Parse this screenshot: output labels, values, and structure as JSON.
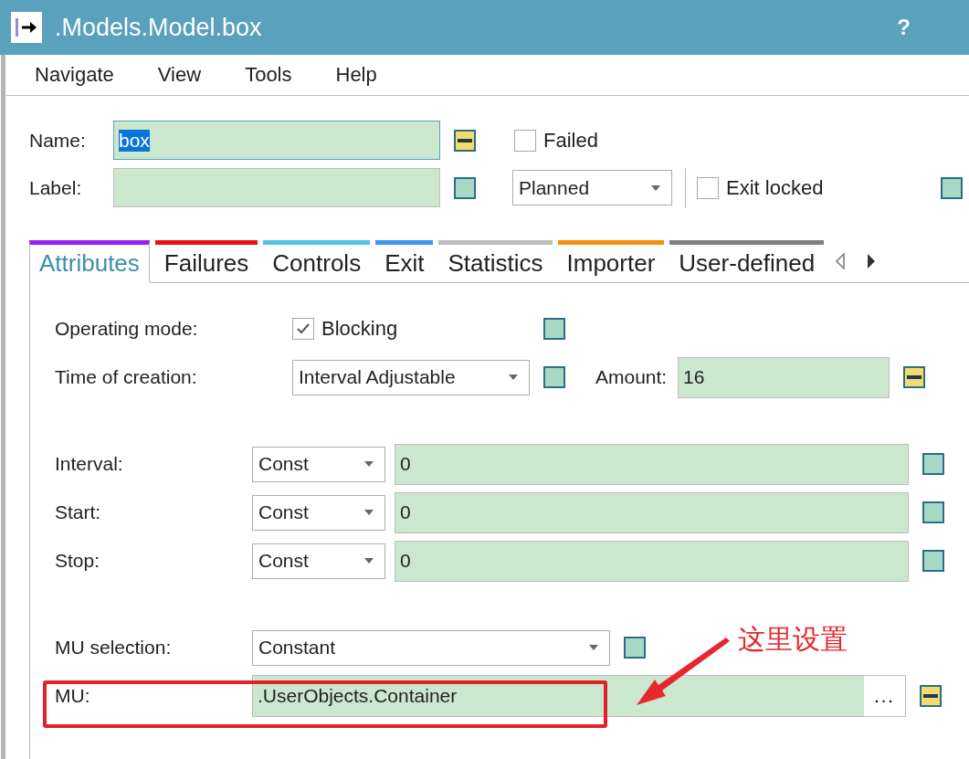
{
  "window": {
    "title": ".Models.Model.box",
    "help": "?"
  },
  "menu": [
    "Navigate",
    "View",
    "Tools",
    "Help"
  ],
  "header": {
    "name": {
      "label": "Name:",
      "value": "box",
      "text_selected": true,
      "inherited": false
    },
    "label": {
      "label": "Label:",
      "inherited": true
    },
    "failed": {
      "label": "Failed",
      "checked": false
    },
    "state": {
      "value": "Planned"
    },
    "exit_locked": {
      "label": "Exit locked",
      "checked": false,
      "inherited": true
    }
  },
  "tabs": [
    {
      "label": "Attributes",
      "color": "#9b1ff0",
      "selected": true
    },
    {
      "label": "Failures",
      "color": "#f01010",
      "selected": false
    },
    {
      "label": "Controls",
      "color": "#4cc4e8",
      "selected": false
    },
    {
      "label": "Exit",
      "color": "#3c96f0",
      "selected": false
    },
    {
      "label": "Statistics",
      "color": "#bdbdbd",
      "selected": false
    },
    {
      "label": "Importer",
      "color": "#f4900c",
      "selected": false
    },
    {
      "label": "User-defined",
      "color": "#808080",
      "selected": false
    }
  ],
  "sections": [
    [
      {
        "kind": "checkbox",
        "label": "Operating mode:",
        "option": "Blocking",
        "checked": true,
        "inherited": true
      },
      {
        "kind": "select_amount",
        "label": "Time of creation:",
        "select": "Interval Adjustable",
        "inherited": true,
        "amount_label": "Amount:",
        "amount": "16",
        "amount_inherited": false
      }
    ],
    [
      {
        "kind": "select_value",
        "label": "Interval:",
        "select": "Const",
        "value": "0",
        "inherited": true
      },
      {
        "kind": "select_value",
        "label": "Start:",
        "select": "Const",
        "value": "0",
        "inherited": true
      },
      {
        "kind": "select_value",
        "label": "Stop:",
        "select": "Const",
        "value": "0",
        "inherited": true
      }
    ],
    [
      {
        "kind": "select",
        "label": "MU selection:",
        "select": "Constant",
        "inherited": true
      },
      {
        "kind": "path",
        "label": "MU:",
        "value": ".UserObjects.Container",
        "button": "...",
        "inherited": false
      }
    ]
  ],
  "annotation": {
    "text": "这里设置"
  }
}
